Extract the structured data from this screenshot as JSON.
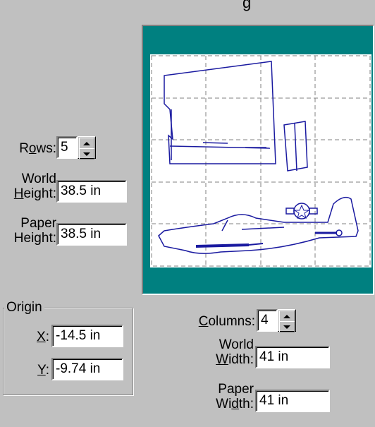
{
  "dialog": {
    "title_fragment": "g"
  },
  "rows": {
    "label_pre": "R",
    "label_key": "o",
    "label_post": "ws:",
    "value": "5"
  },
  "world_height": {
    "label_line1": "World",
    "label_key": "H",
    "label_post": "eight:",
    "value": "38.5 in"
  },
  "paper_height": {
    "label_line1": "Paper",
    "label_line2": "Height:",
    "value": "38.5 in"
  },
  "origin": {
    "title": "Origin",
    "x": {
      "label_key": "X",
      "label_post": ":",
      "value": "-14.5 in"
    },
    "y": {
      "label_key": "Y",
      "label_post": ":",
      "value": "-9.74 in"
    }
  },
  "columns": {
    "label_key": "C",
    "label_post": "olumns:",
    "value": "4"
  },
  "world_width": {
    "label_line1": "World",
    "label_key": "W",
    "label_post": "idth:",
    "value": "41 in"
  },
  "paper_width": {
    "label_line1": "Paper",
    "label_pre": "Wi",
    "label_key": "d",
    "label_post": "th:",
    "value": "41 in"
  },
  "preview": {
    "background_color": "#008080",
    "page_color": "#ffffff",
    "drawing_color": "#1a1aa0",
    "grid_rows": 5,
    "grid_columns": 4
  }
}
